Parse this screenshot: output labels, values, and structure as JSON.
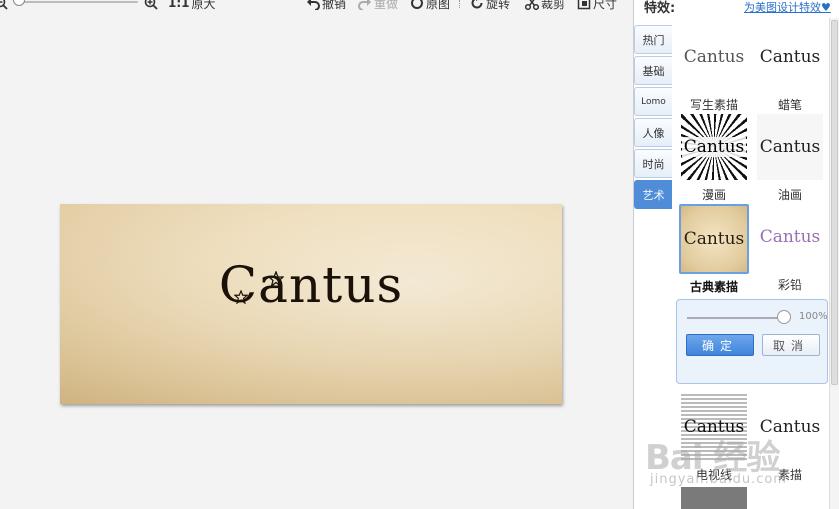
{
  "toolbar": {
    "original_size": "原大",
    "undo": "撤销",
    "redo": "重做",
    "original": "原图",
    "rotate": "旋转",
    "crop": "裁剪",
    "size": "尺寸"
  },
  "canvas": {
    "image_text": "Cantus"
  },
  "panel": {
    "title": "特效:",
    "link": "为美图设计特效♥",
    "tabs": [
      "热门",
      "基础",
      "Lomo",
      "人像",
      "时尚",
      "艺术"
    ],
    "active_tab": "艺术",
    "effects": [
      {
        "label": "写生素描",
        "preview": "Cantus"
      },
      {
        "label": "蜡笔",
        "preview": "Cantus"
      },
      {
        "label": "漫画",
        "preview": "Cantus"
      },
      {
        "label": "油画",
        "preview": "Cantus"
      },
      {
        "label": "古典素描",
        "preview": "Cantus",
        "selected": true
      },
      {
        "label": "彩铅",
        "preview": "Cantus"
      },
      {
        "label": "电视线",
        "preview": "Cantus"
      },
      {
        "label": "素描",
        "preview": "Cantus"
      }
    ],
    "intensity": {
      "value": 100,
      "label": "100%"
    },
    "confirm": "确定",
    "cancel": "取消"
  },
  "watermark": {
    "text": "Bai 经验",
    "sub": "jingyan.baidu.com"
  },
  "colors": {
    "accent": "#4f8dd9",
    "link": "#2a6fc9",
    "background": "#f3f3f3"
  }
}
